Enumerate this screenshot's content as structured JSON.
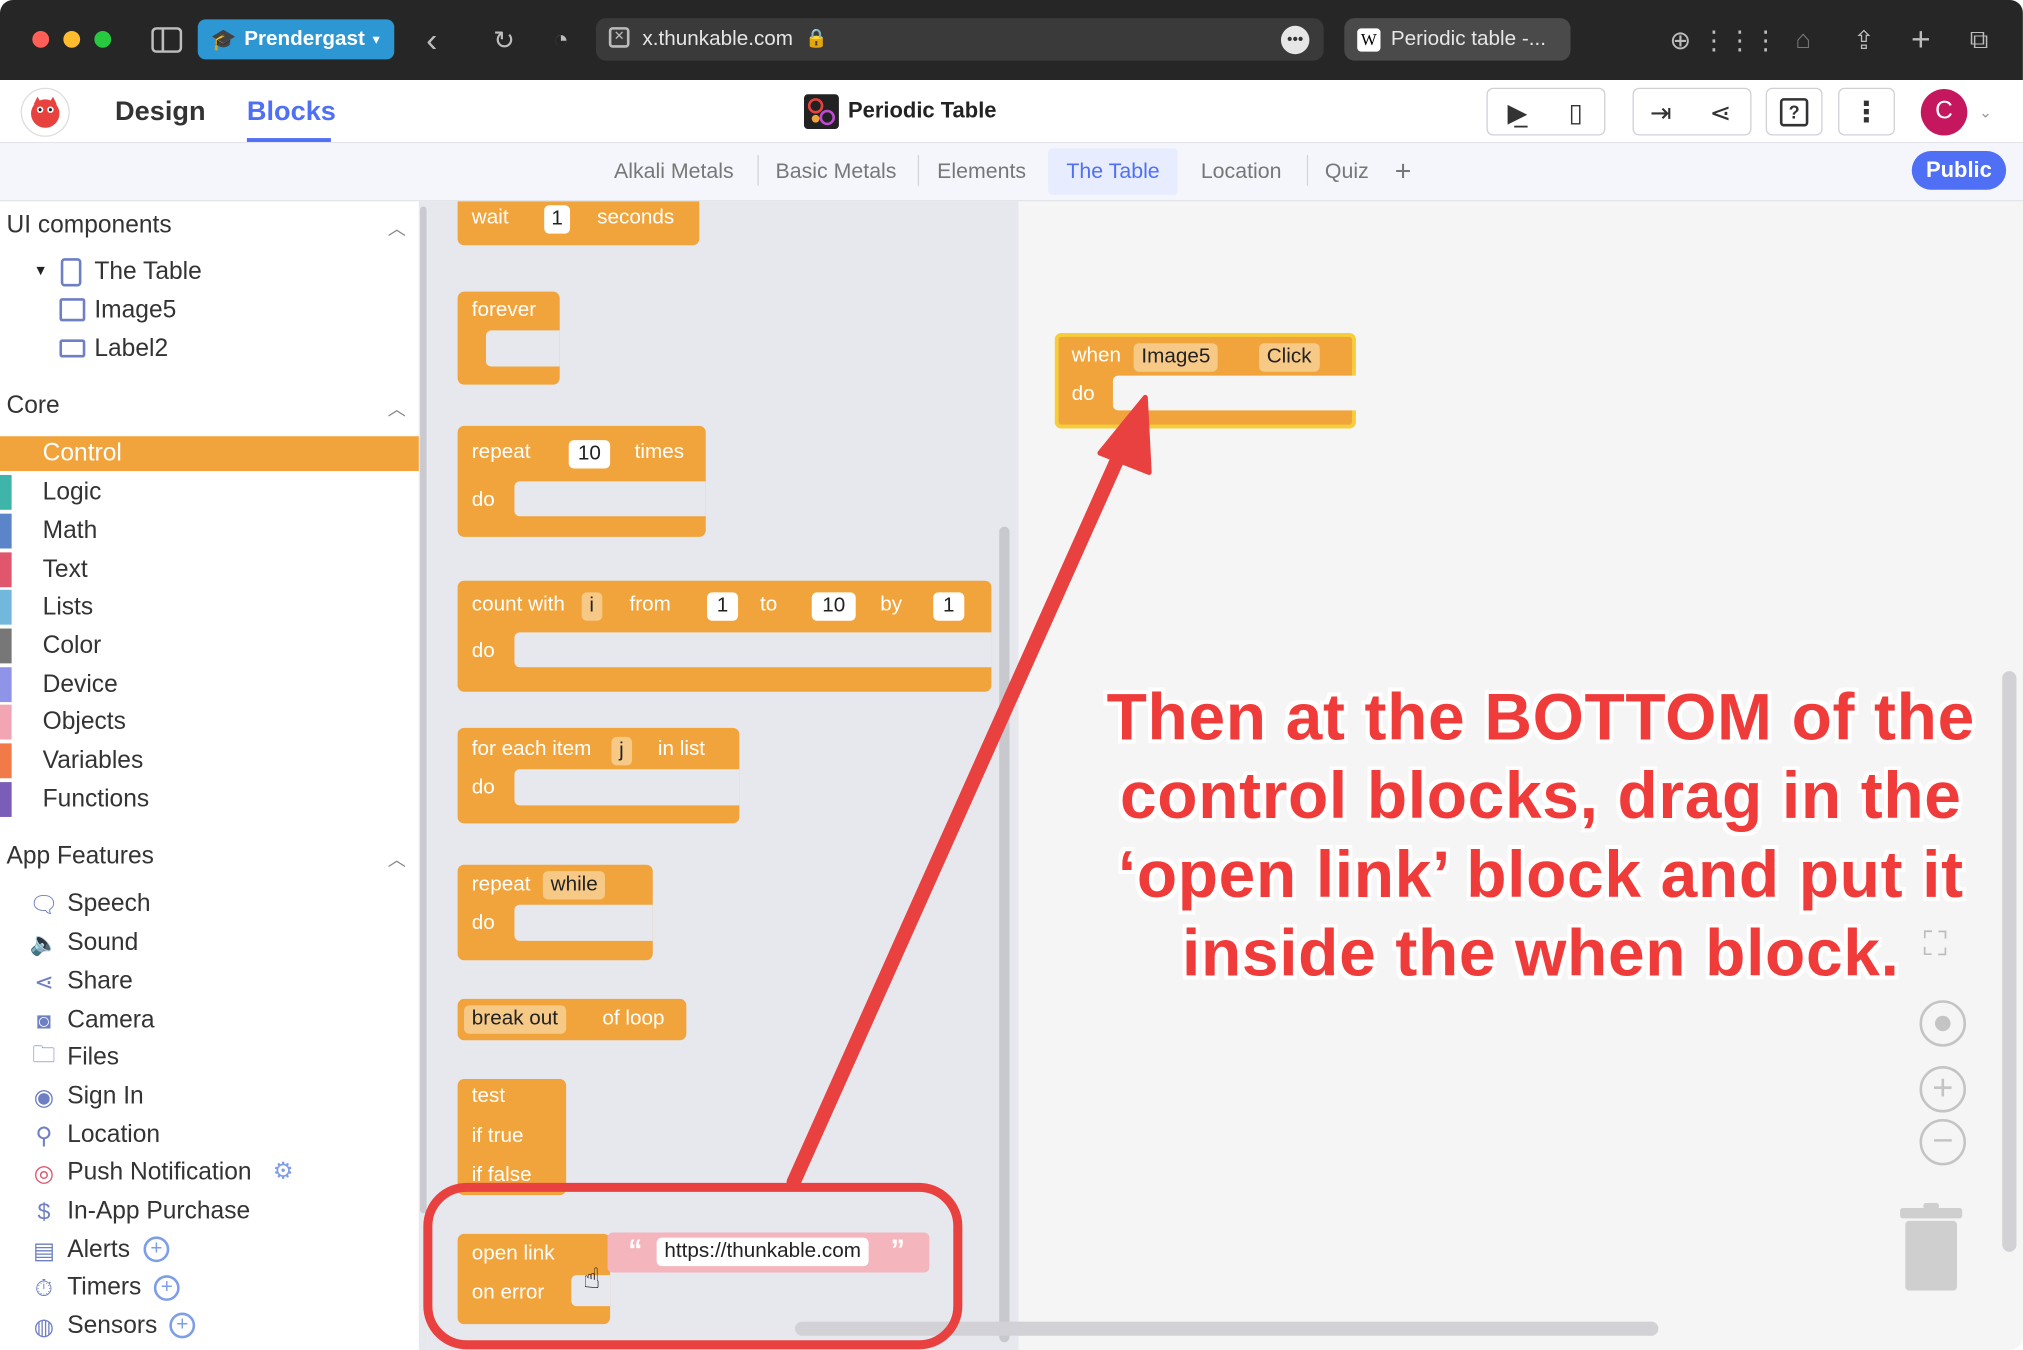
{
  "browser": {
    "profile": "Prendergast",
    "url": "x.thunkable.com",
    "other_tab": "Periodic table -..."
  },
  "app": {
    "nav_design": "Design",
    "nav_blocks": "Blocks",
    "project_title": "Periodic Table",
    "avatar_letter": "C",
    "toolbar_icons": [
      "preview-icon",
      "live-test-icon",
      "download-icon",
      "share-icon",
      "help-icon",
      "more-icon"
    ]
  },
  "screens": {
    "tabs": [
      "Alkali Metals",
      "Basic Metals",
      "Elements",
      "The Table",
      "Location",
      "Quiz"
    ],
    "active": "The Table",
    "add": "+",
    "public_label": "Public"
  },
  "sidebar": {
    "ui_header": "UI components",
    "tree_root": "The Table",
    "tree_children": [
      "Image5",
      "Label2"
    ],
    "core_header": "Core",
    "core": [
      {
        "label": "Control",
        "color": "#f1a43b",
        "active": true
      },
      {
        "label": "Logic",
        "color": "#3fb5a9"
      },
      {
        "label": "Math",
        "color": "#5b84c9"
      },
      {
        "label": "Text",
        "color": "#e0566d"
      },
      {
        "label": "Lists",
        "color": "#72b8dd"
      },
      {
        "label": "Color",
        "color": "#777777"
      },
      {
        "label": "Device",
        "color": "#8f94e8"
      },
      {
        "label": "Objects",
        "color": "#f2a5b3"
      },
      {
        "label": "Variables",
        "color": "#f27a48"
      },
      {
        "label": "Functions",
        "color": "#7a5db6"
      }
    ],
    "features_header": "App Features",
    "features": [
      {
        "label": "Speech",
        "icon": "speech-icon",
        "extra": ""
      },
      {
        "label": "Sound",
        "icon": "sound-icon",
        "extra": ""
      },
      {
        "label": "Share",
        "icon": "share-icon",
        "extra": ""
      },
      {
        "label": "Camera",
        "icon": "camera-icon",
        "extra": ""
      },
      {
        "label": "Files",
        "icon": "files-icon",
        "extra": ""
      },
      {
        "label": "Sign In",
        "icon": "sign-in-icon",
        "extra": ""
      },
      {
        "label": "Location",
        "icon": "location-icon",
        "extra": ""
      },
      {
        "label": "Push Notification",
        "icon": "push-notification-icon",
        "extra": "gear"
      },
      {
        "label": "In-App Purchase",
        "icon": "purchase-icon",
        "extra": ""
      },
      {
        "label": "Alerts",
        "icon": "alerts-icon",
        "extra": "plus"
      },
      {
        "label": "Timers",
        "icon": "timers-icon",
        "extra": "plus"
      },
      {
        "label": "Sensors",
        "icon": "sensors-icon",
        "extra": "plus"
      }
    ]
  },
  "flyout": {
    "wait": {
      "label": "wait",
      "value": "1",
      "unit": "seconds"
    },
    "forever": "forever",
    "repeat": {
      "label": "repeat",
      "value": "10",
      "unit": "times",
      "do": "do"
    },
    "count": {
      "label": "count with",
      "var": "i",
      "from": "from",
      "from_val": "1",
      "to": "to",
      "to_val": "10",
      "by": "by",
      "by_val": "1",
      "do": "do"
    },
    "foreach": {
      "label": "for each item",
      "var": "j",
      "in": "in list",
      "do": "do"
    },
    "repeat_while": {
      "label": "repeat",
      "mode": "while",
      "do": "do"
    },
    "break": {
      "mode": "break out",
      "suffix": "of loop"
    },
    "test": {
      "label": "test",
      "if_true": "if true",
      "if_false": "if false"
    },
    "open_link": {
      "label": "open link",
      "on_error": "on error",
      "url": "https://thunkable.com",
      "open_quote": "“",
      "close_quote": "”"
    }
  },
  "workspace": {
    "event_block": {
      "when": "when",
      "component": "Image5",
      "event": "Click",
      "do": "do"
    },
    "annotation": "Then at the BOTTOM of the control blocks, drag in the ‘open link’ block and put it inside the when block."
  }
}
